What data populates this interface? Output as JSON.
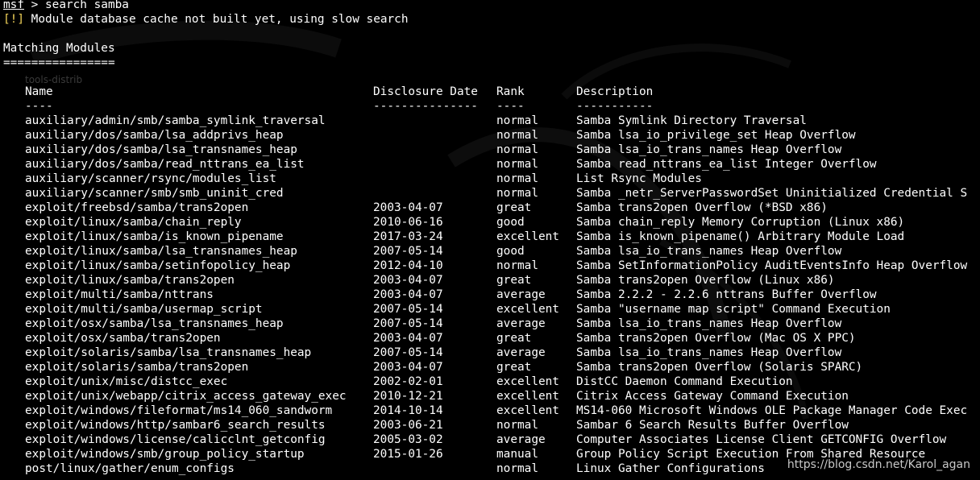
{
  "terminal": {
    "prompt": "msf",
    "command": " > search samba",
    "warning_tag": "[!]",
    "warning_text": " Module database cache not built yet, using slow search",
    "section_title": "Matching Modules",
    "section_rule": "================",
    "ghost_text": "tools-distrib",
    "colors": {
      "background": "#000000",
      "text": "#ffffff",
      "warning": "#f2d35a"
    }
  },
  "table": {
    "headers": {
      "name": "Name",
      "date": "Disclosure Date",
      "rank": "Rank",
      "description": "Description"
    },
    "separators": {
      "name": "----",
      "date": "---------------",
      "rank": "----",
      "description": "-----------"
    },
    "rows": [
      {
        "name": "auxiliary/admin/smb/samba_symlink_traversal",
        "date": "",
        "rank": "normal",
        "description": "Samba Symlink Directory Traversal"
      },
      {
        "name": "auxiliary/dos/samba/lsa_addprivs_heap",
        "date": "",
        "rank": "normal",
        "description": "Samba lsa_io_privilege_set Heap Overflow"
      },
      {
        "name": "auxiliary/dos/samba/lsa_transnames_heap",
        "date": "",
        "rank": "normal",
        "description": "Samba lsa_io_trans_names Heap Overflow"
      },
      {
        "name": "auxiliary/dos/samba/read_nttrans_ea_list",
        "date": "",
        "rank": "normal",
        "description": "Samba read_nttrans_ea_list Integer Overflow"
      },
      {
        "name": "auxiliary/scanner/rsync/modules_list",
        "date": "",
        "rank": "normal",
        "description": "List Rsync Modules"
      },
      {
        "name": "auxiliary/scanner/smb/smb_uninit_cred",
        "date": "",
        "rank": "normal",
        "description": "Samba _netr_ServerPasswordSet Uninitialized Credential S"
      },
      {
        "name": "exploit/freebsd/samba/trans2open",
        "date": "2003-04-07",
        "rank": "great",
        "description": "Samba trans2open Overflow (*BSD x86)"
      },
      {
        "name": "exploit/linux/samba/chain_reply",
        "date": "2010-06-16",
        "rank": "good",
        "description": "Samba chain_reply Memory Corruption (Linux x86)"
      },
      {
        "name": "exploit/linux/samba/is_known_pipename",
        "date": "2017-03-24",
        "rank": "excellent",
        "description": "Samba is_known_pipename() Arbitrary Module Load"
      },
      {
        "name": "exploit/linux/samba/lsa_transnames_heap",
        "date": "2007-05-14",
        "rank": "good",
        "description": "Samba lsa_io_trans_names Heap Overflow"
      },
      {
        "name": "exploit/linux/samba/setinfopolicy_heap",
        "date": "2012-04-10",
        "rank": "normal",
        "description": "Samba SetInformationPolicy AuditEventsInfo Heap Overflow"
      },
      {
        "name": "exploit/linux/samba/trans2open",
        "date": "2003-04-07",
        "rank": "great",
        "description": "Samba trans2open Overflow (Linux x86)"
      },
      {
        "name": "exploit/multi/samba/nttrans",
        "date": "2003-04-07",
        "rank": "average",
        "description": "Samba 2.2.2 - 2.2.6 nttrans Buffer Overflow"
      },
      {
        "name": "exploit/multi/samba/usermap_script",
        "date": "2007-05-14",
        "rank": "excellent",
        "description": "Samba \"username map script\" Command Execution"
      },
      {
        "name": "exploit/osx/samba/lsa_transnames_heap",
        "date": "2007-05-14",
        "rank": "average",
        "description": "Samba lsa_io_trans_names Heap Overflow"
      },
      {
        "name": "exploit/osx/samba/trans2open",
        "date": "2003-04-07",
        "rank": "great",
        "description": "Samba trans2open Overflow (Mac OS X PPC)"
      },
      {
        "name": "exploit/solaris/samba/lsa_transnames_heap",
        "date": "2007-05-14",
        "rank": "average",
        "description": "Samba lsa_io_trans_names Heap Overflow"
      },
      {
        "name": "exploit/solaris/samba/trans2open",
        "date": "2003-04-07",
        "rank": "great",
        "description": "Samba trans2open Overflow (Solaris SPARC)"
      },
      {
        "name": "exploit/unix/misc/distcc_exec",
        "date": "2002-02-01",
        "rank": "excellent",
        "description": "DistCC Daemon Command Execution"
      },
      {
        "name": "exploit/unix/webapp/citrix_access_gateway_exec",
        "date": "2010-12-21",
        "rank": "excellent",
        "description": "Citrix Access Gateway Command Execution"
      },
      {
        "name": "exploit/windows/fileformat/ms14_060_sandworm",
        "date": "2014-10-14",
        "rank": "excellent",
        "description": "MS14-060 Microsoft Windows OLE Package Manager Code Exec"
      },
      {
        "name": "exploit/windows/http/sambar6_search_results",
        "date": "2003-06-21",
        "rank": "normal",
        "description": "Sambar 6 Search Results Buffer Overflow"
      },
      {
        "name": "exploit/windows/license/calicclnt_getconfig",
        "date": "2005-03-02",
        "rank": "average",
        "description": "Computer Associates License Client GETCONFIG Overflow"
      },
      {
        "name": "exploit/windows/smb/group_policy_startup",
        "date": "2015-01-26",
        "rank": "manual",
        "description": "Group Policy Script Execution From Shared Resource"
      },
      {
        "name": "post/linux/gather/enum_configs",
        "date": "",
        "rank": "normal",
        "description": "Linux Gather Configurations"
      }
    ]
  },
  "watermark": "https://blog.csdn.net/Karol_agan"
}
